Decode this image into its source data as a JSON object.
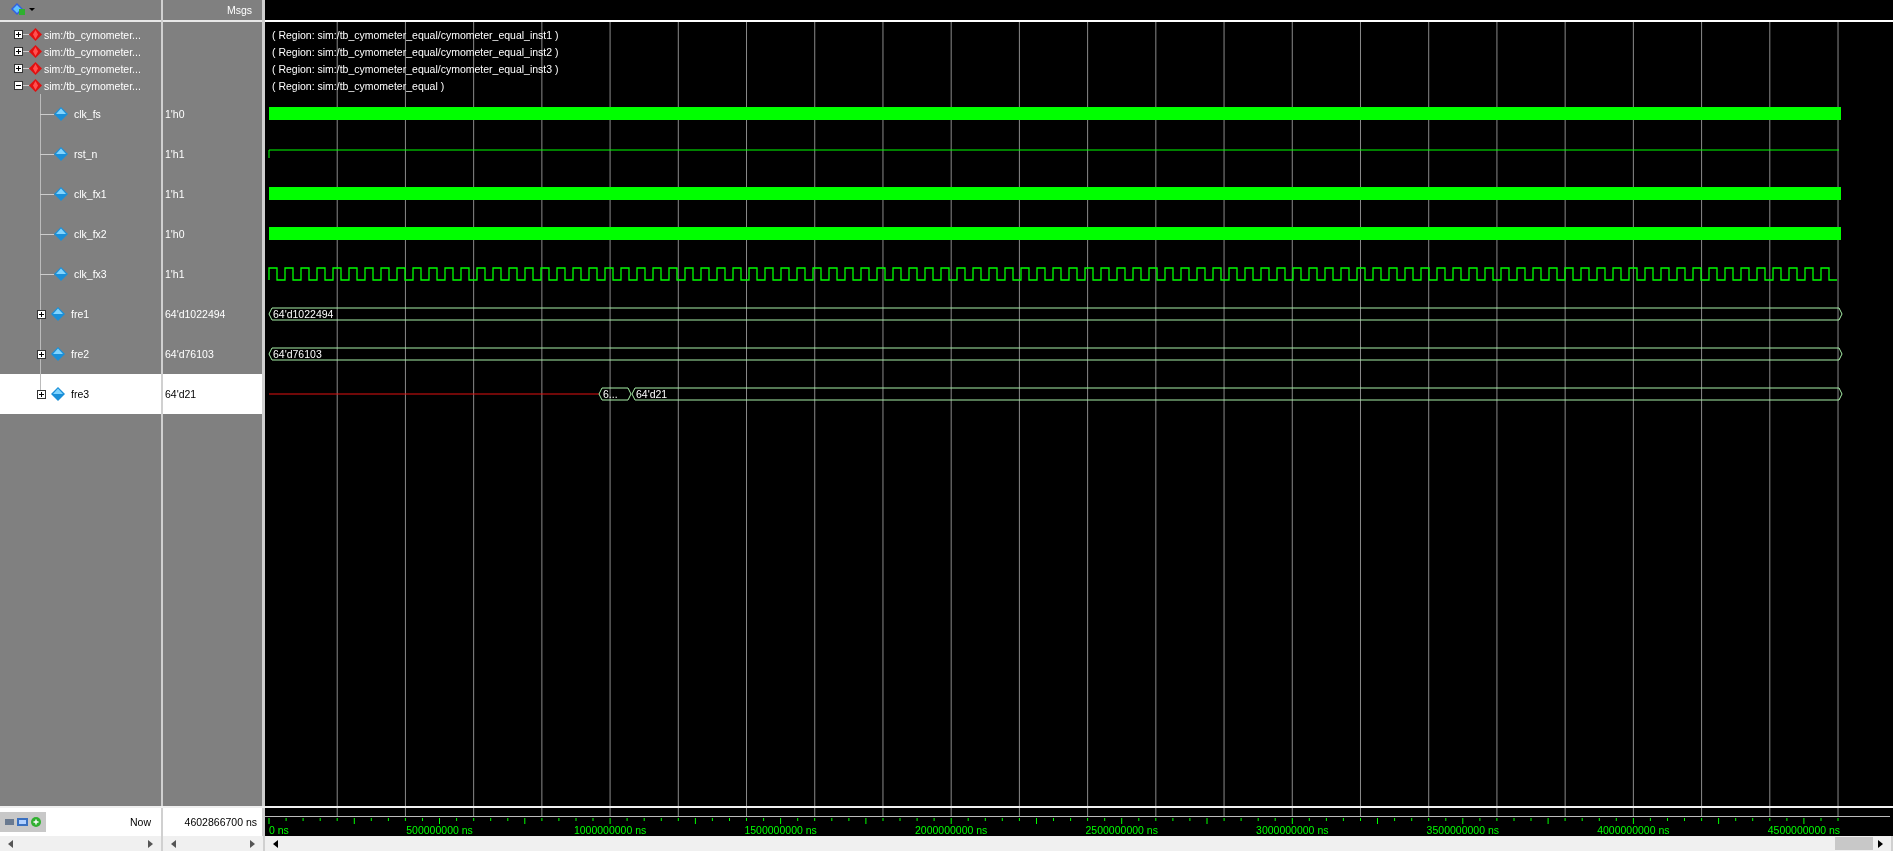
{
  "header": {
    "values_title": "Msgs"
  },
  "groups": [
    {
      "label": "sim:/tb_cymometer...",
      "region": "( Region: sim:/tb_cymometer_equal/cymometer_equal_inst1 )",
      "expanded": false
    },
    {
      "label": "sim:/tb_cymometer...",
      "region": "( Region: sim:/tb_cymometer_equal/cymometer_equal_inst2 )",
      "expanded": false
    },
    {
      "label": "sim:/tb_cymometer...",
      "region": "( Region: sim:/tb_cymometer_equal/cymometer_equal_inst3 )",
      "expanded": false
    },
    {
      "label": "sim:/tb_cymometer...",
      "region": "( Region: sim:/tb_cymometer_equal )",
      "expanded": true,
      "children": [
        {
          "name": "clk_fs",
          "value": "1'h0",
          "kind": "dense",
          "selected": false
        },
        {
          "name": "rst_n",
          "value": "1'h1",
          "kind": "step",
          "selected": false
        },
        {
          "name": "clk_fx1",
          "value": "1'h1",
          "kind": "dense",
          "selected": false
        },
        {
          "name": "clk_fx2",
          "value": "1'h0",
          "kind": "dense",
          "selected": false
        },
        {
          "name": "clk_fx3",
          "value": "1'h1",
          "kind": "clock",
          "selected": false
        },
        {
          "name": "fre1",
          "value": "64'd1022494",
          "kind": "bus",
          "expanded": false,
          "selected": false,
          "segments": [
            "64'd1022494"
          ]
        },
        {
          "name": "fre2",
          "value": "64'd76103",
          "kind": "bus",
          "expanded": false,
          "selected": false,
          "segments": [
            "64'd76103"
          ]
        },
        {
          "name": "fre3",
          "value": "64'd21",
          "kind": "late_bus",
          "expanded": false,
          "selected": true,
          "segments": [
            "6...",
            "64'd21"
          ]
        }
      ]
    }
  ],
  "cursor": {
    "label": "Now",
    "time": "4602866700 ns"
  },
  "time_axis": [
    "0 ns",
    "500000000 ns",
    "1000000000 ns",
    "1500000000 ns",
    "2000000000 ns",
    "2500000000 ns",
    "3000000000 ns",
    "3500000000 ns",
    "4000000000 ns",
    "4500000000 ns"
  ]
}
